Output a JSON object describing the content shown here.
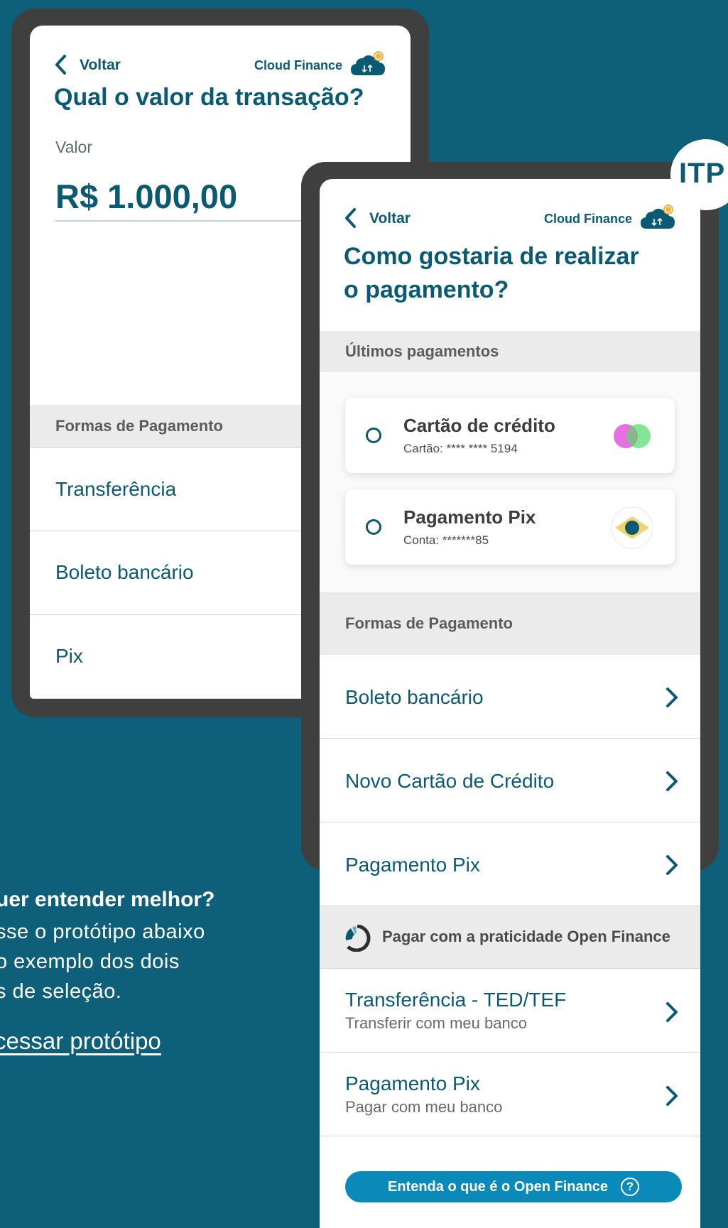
{
  "back_screen": {
    "header": {
      "back_label": "Voltar",
      "brand": "Cloud Finance"
    },
    "title": "Qual o valor da transação?",
    "valor_label": "Valor",
    "amount": "R$ 1.000,00",
    "section_label": "Formas de Pagamento",
    "options": [
      "Transferência",
      "Boleto bancário",
      "Pix"
    ]
  },
  "front_screen": {
    "header": {
      "back_label": "Voltar",
      "brand": "Cloud Finance"
    },
    "title_line1": "Como gostaria de realizar",
    "title_line2": "o pagamento?",
    "recent_label": "Últimos pagamentos",
    "recent": [
      {
        "title": "Cartão de crédito",
        "sub": "Cartão: **** **** 5194",
        "icon": "card-brand-icon"
      },
      {
        "title": "Pagamento Pix",
        "sub": "Conta: *******85",
        "icon": "bank-brazil-icon"
      }
    ],
    "methods_label": "Formas de Pagamento",
    "methods": [
      "Boleto bancário",
      "Novo Cartão de Crédito",
      "Pagamento Pix"
    ],
    "open_finance_label": "Pagar com a praticidade Open Finance",
    "open_finance_options": [
      {
        "title": "Transferência - TED/TEF",
        "sub": "Transferir com meu banco"
      },
      {
        "title": "Pagamento Pix",
        "sub": "Pagar com meu banco"
      }
    ],
    "cta_label": "Entenda o que é o Open Finance",
    "cta_icon": "?"
  },
  "badge": "ITP",
  "side": {
    "title": "uer entender melhor?",
    "lines": [
      "sse o protótipo abaixo",
      " o exemplo dos dois",
      "s de seleção."
    ],
    "link": "cessar protótipo"
  },
  "colors": {
    "background": "#0e5f7a",
    "primary": "#0b5a74",
    "accent": "#0a8ab8",
    "frame": "#3f3f3f"
  }
}
